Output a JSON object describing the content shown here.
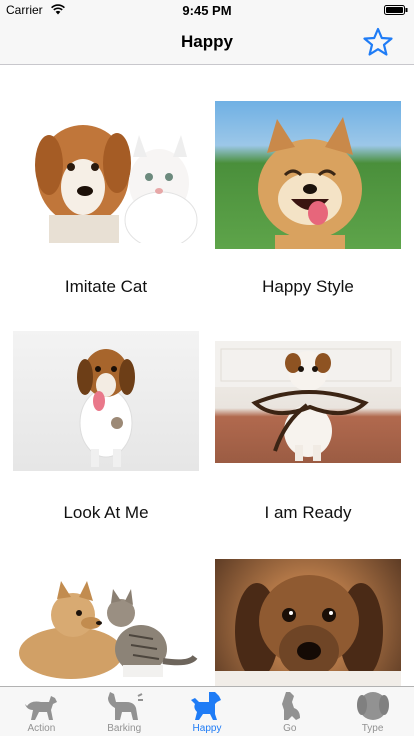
{
  "status_bar": {
    "carrier": "Carrier",
    "time": "9:45 PM"
  },
  "nav": {
    "title": "Happy",
    "right_icon": "star-outline-icon"
  },
  "grid": {
    "items": [
      {
        "caption": "Imitate Cat"
      },
      {
        "caption": "Happy Style"
      },
      {
        "caption": "Look At Me"
      },
      {
        "caption": "I am Ready"
      },
      {
        "caption": ""
      },
      {
        "caption": ""
      }
    ]
  },
  "tab_bar": {
    "tabs": [
      {
        "label": "Action",
        "icon": "dog-walking-icon"
      },
      {
        "label": "Barking",
        "icon": "dog-barking-icon"
      },
      {
        "label": "Happy",
        "icon": "dog-happy-icon"
      },
      {
        "label": "Go",
        "icon": "dog-sitting-icon"
      },
      {
        "label": "Type",
        "icon": "dog-head-icon"
      }
    ],
    "active_index": 2
  },
  "colors": {
    "accent": "#1f7cf6",
    "inactive": "#929292",
    "bar_bg": "#f7f7f7"
  }
}
